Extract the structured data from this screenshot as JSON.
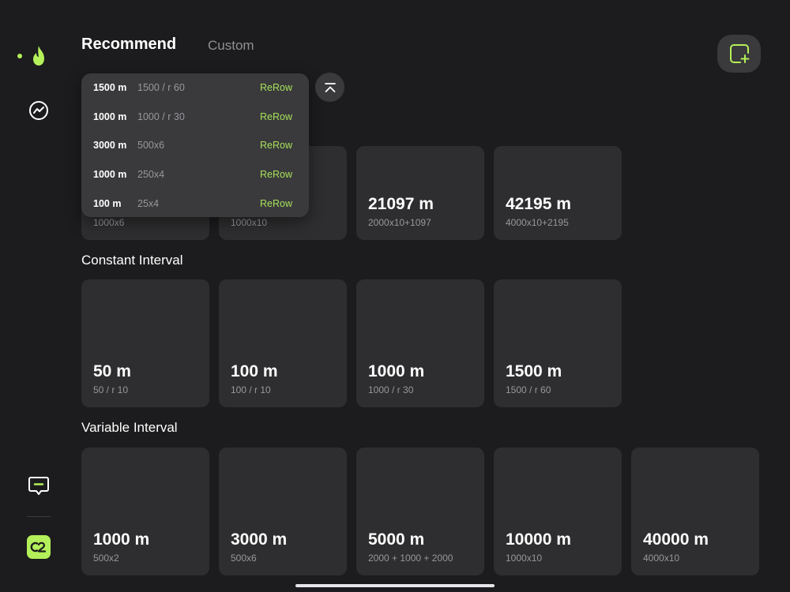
{
  "header": {
    "tabs": [
      {
        "label": "Recommend",
        "active": true
      },
      {
        "label": "Custom",
        "active": false
      }
    ]
  },
  "colors": {
    "background": "#1c1c1e",
    "card": "#2e2e30",
    "accent": "#b4f05a",
    "secondary_text": "#98989d"
  },
  "sidebar": {
    "icons": [
      "flame-icon",
      "trend-chart-icon",
      "message-icon",
      "brand-logo-icon"
    ],
    "brand_text": "C2"
  },
  "popup": {
    "items": [
      {
        "distance": "1500 m",
        "plan": "1500 / r 60",
        "action": "ReRow"
      },
      {
        "distance": "1000 m",
        "plan": "1000 / r 30",
        "action": "ReRow"
      },
      {
        "distance": "3000 m",
        "plan": "500x6",
        "action": "ReRow"
      },
      {
        "distance": "1000 m",
        "plan": "250x4",
        "action": "ReRow"
      },
      {
        "distance": "100 m",
        "plan": "25x4",
        "action": "ReRow"
      }
    ]
  },
  "sections": [
    {
      "title": "",
      "cards": [
        {
          "title": "",
          "subtitle": "1000x6"
        },
        {
          "title": "",
          "subtitle": "1000x10"
        },
        {
          "title": "21097 m",
          "subtitle": "2000x10+1097"
        },
        {
          "title": "42195 m",
          "subtitle": "4000x10+2195"
        }
      ]
    },
    {
      "title": "Constant Interval",
      "cards": [
        {
          "title": "50 m",
          "subtitle": "50 / r 10"
        },
        {
          "title": "100 m",
          "subtitle": "100 / r 10"
        },
        {
          "title": "1000 m",
          "subtitle": "1000 / r 30"
        },
        {
          "title": "1500 m",
          "subtitle": "1500 / r 60"
        }
      ]
    },
    {
      "title": "Variable Interval",
      "cards": [
        {
          "title": "1000 m",
          "subtitle": "500x2"
        },
        {
          "title": "3000 m",
          "subtitle": "500x6"
        },
        {
          "title": "5000 m",
          "subtitle": "2000 + 1000 + 2000"
        },
        {
          "title": "10000 m",
          "subtitle": "1000x10"
        },
        {
          "title": "40000 m",
          "subtitle": "4000x10"
        }
      ]
    }
  ]
}
